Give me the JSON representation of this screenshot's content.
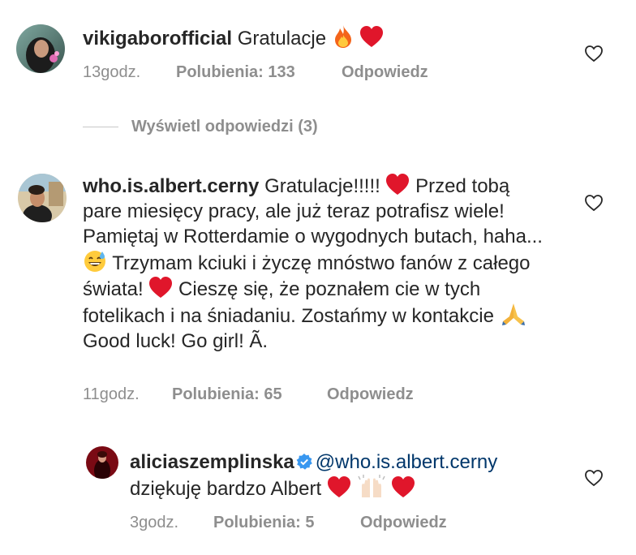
{
  "comments": [
    {
      "username": "vikigaborofficial",
      "text": "Gratulacje",
      "time": "13godz.",
      "likes": "Polubienia: 133",
      "reply": "Odpowiedz"
    },
    {
      "username": "who.is.albert.cerny",
      "text_parts": [
        "Gratulacje!!!!!",
        "Przed tobą pare miesięcy pracy, ale już teraz potrafisz wiele! Pamiętaj w Rotterdamie o wygodnych butach, haha...",
        "Trzymam kciuki i życzę mnóstwo fanów z całego świata!",
        "Cieszę się, że poznałem cie w tych fotelikach i na śniadaniu. Zostańmy w kontakcie",
        "Good luck! Go girl! Ã."
      ],
      "time": "11godz.",
      "likes": "Polubienia: 65",
      "reply": "Odpowiedz"
    },
    {
      "username": "aliciaszemplinska",
      "mention": "@who.is.albert.cerny",
      "text": "dziękuję bardzo Albert",
      "time": "3godz.",
      "likes": "Polubienia: 5",
      "reply": "Odpowiedz"
    }
  ],
  "view_replies": "Wyświetl odpowiedzi (3)",
  "icons": {
    "like": "heart-outline-icon",
    "verified": "verified-badge-icon"
  },
  "colors": {
    "text": "#262626",
    "meta": "#8e8e8e",
    "mention": "#00376b",
    "verified": "#3897f0",
    "heart_emoji": "#e0162b"
  }
}
